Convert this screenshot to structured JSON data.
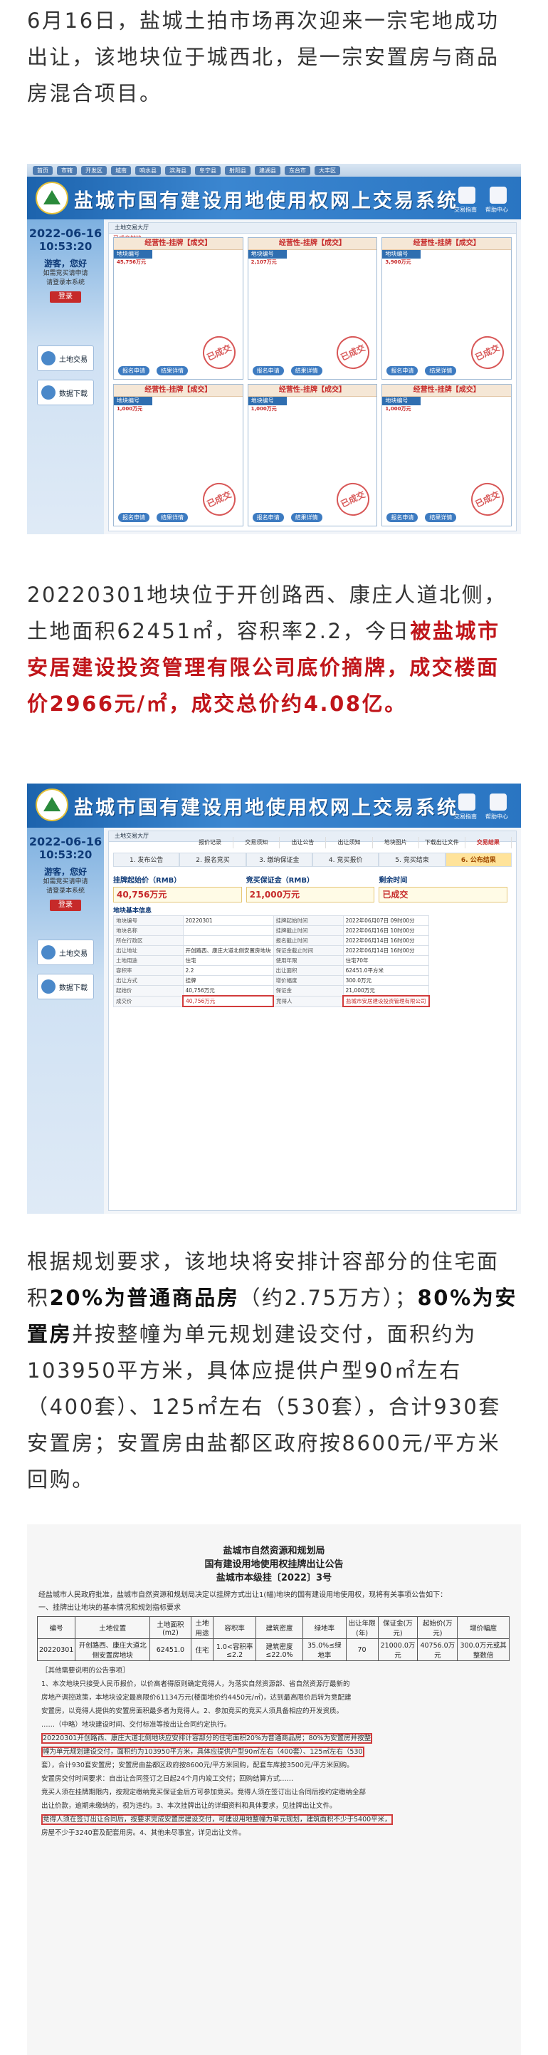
{
  "paragraphs": {
    "p1": "6月16日，盐城土拍市场再次迎来一宗宅地成功出让，该地块位于城西北，是一宗安置房与商品房混合项目。",
    "p2_a": "20220301地块位于开创路西、康庄人道北侧，土地面积62451㎡，容积率2.2，今日",
    "p2_red": "被盐城市安居建设投资管理有限公司底价摘牌，成交楼面价2966元/㎡，成交总价约4.08亿。",
    "p3_a": "根据规划要求，该地块将安排计容部分的住宅面积",
    "p3_b1": "20%为普通商品房",
    "p3_c": "（约2.75万方）；",
    "p3_b2": "80%为安置房",
    "p3_d": "并按整幢为单元规划建设交付，面积约为103950平方米，具体应提供户型90㎡左右（400套）、125㎡左右（530套），合计930套安置房；安置房由盐都区政府按8600元/平方米回购。"
  },
  "site": {
    "title": "盐城市国有建设用地使用权网上交易系统",
    "nav": [
      "首页",
      "市辖",
      "开发区",
      "城南",
      "响水县",
      "滨海县",
      "阜宁县",
      "射阳县",
      "建湖县",
      "东台市",
      "大丰区"
    ],
    "hdr_icons": [
      "交易指南",
      "帮助中心"
    ],
    "sidebar": {
      "greet": "游客，您好",
      "tip1": "如需竞买请申请",
      "tip2": "请登录本系统",
      "login": "登录",
      "btn1": "土地交易",
      "btn2": "数据下载"
    }
  },
  "shot1": {
    "date": "2022-06-16",
    "time": "10:53:20",
    "tab": "土地交易大厅",
    "subtab": "已成交地块",
    "cards": [
      {
        "title": "经营性-挂牌【成交】",
        "code": "地块编号",
        "price": "45,756万元",
        "stamp": "已成交"
      },
      {
        "title": "经营性-挂牌【成交】",
        "code": "地块编号",
        "price": "2,107万元",
        "stamp": "已成交"
      },
      {
        "title": "经营性-挂牌【成交】",
        "code": "地块编号",
        "price": "3,900万元",
        "stamp": "已成交"
      },
      {
        "title": "经营性-挂牌【成交】",
        "code": "地块编号",
        "price": "1,000万元",
        "stamp": "已成交"
      },
      {
        "title": "经营性-挂牌【成交】",
        "code": "地块编号",
        "price": "1,000万元",
        "stamp": "已成交"
      },
      {
        "title": "经营性-挂牌【成交】",
        "code": "地块编号",
        "price": "1,000万元",
        "stamp": "已成交"
      }
    ],
    "btn_detail": "报名申请",
    "btn_result": "结果详情"
  },
  "shot2": {
    "date": "2022-06-16",
    "time": "10:53:20",
    "tab": "土地交易大厅",
    "subtabs": [
      "报价记录",
      "交易须知",
      "出让公告",
      "出让须知",
      "地块图片",
      "下载出让文件",
      "交易结果"
    ],
    "steps": [
      "发布公告",
      "报名竞买",
      "缴纳保证金",
      "竞买报价",
      "竞买结束",
      "公布结果"
    ],
    "kpis": [
      {
        "label": "挂牌起始价（RMB）",
        "value": "40,756万元"
      },
      {
        "label": "竞买保证金（RMB）",
        "value": "21,000万元"
      },
      {
        "label": "剩余时间",
        "value": "已成交"
      }
    ],
    "section": "地块基本信息",
    "rows": [
      [
        "地块编号",
        "20220301",
        "挂牌起始时间",
        "2022年06月07日 09时00分"
      ],
      [
        "地块名称",
        "",
        "挂牌截止时间",
        "2022年06月16日 10时00分"
      ],
      [
        "所在行政区",
        "",
        "报名截止时间",
        "2022年06月14日 16时00分"
      ],
      [
        "出让地址",
        "开创路西、康庄大道北侧安置房地块",
        "保证金截止时间",
        "2022年06月14日 16时00分"
      ],
      [
        "土地用途",
        "住宅",
        "使用年限",
        "住宅70年"
      ],
      [
        "容积率",
        "2.2",
        "出让面积",
        "62451.0平方米"
      ],
      [
        "出让方式",
        "挂牌",
        "增价幅度",
        "300.0万元"
      ],
      [
        "起始价",
        "40,756万元",
        "保证金",
        "21,000万元"
      ],
      [
        "成交价",
        "40,756万元",
        "竞得人",
        "盐城市安居建设投资管理有限公司"
      ]
    ]
  },
  "notice": {
    "t1": "盐城市自然资源和规划局",
    "t2": "国有建设用地使用权挂牌出让公告",
    "t3": "盐城市本级挂〔2022〕3号",
    "intro": "经盐城市人民政府批准，盐城市自然资源和规划局决定以挂牌方式出让1(幅)地块的国有建设用地使用权，现将有关事项公告如下：",
    "sec1": "一、挂牌出让地块的基本情况和规划指标要求",
    "headers": [
      "编号",
      "土地位置",
      "土地面积(m2)",
      "土地用途",
      "容积率",
      "建筑密度",
      "绿地率",
      "出让年限(年)",
      "保证金(万元)",
      "起始价(万元)",
      "增价幅度"
    ],
    "row": [
      "20220301",
      "开创路西、康庄大道北侧安置房地块",
      "62451.0",
      "住宅",
      "1.0<容积率≤2.2",
      "建筑密度≤22.0%",
      "35.0%≤绿地率",
      "70",
      "21000.0万元",
      "40756.0万元",
      "300.0万元或其整数倍"
    ],
    "other": "［其他需要说明的公告事项］",
    "body": [
      "1、本次地块只接受人民币报价，以价高者得原则确定竞得人，为落实自然资源部、省自然资源厅最新的",
      "房地产调控政策，本地块设定最高限价61134万元(楼面地价约4450元/㎡)，达到最高限价后转为竞配建",
      "安置房，以竞得人提供的安置房面积最多者为竞得人。2、参加竞买的竞买人须具备相应的开发资质。",
      "……（中略）地块建设时间、交付标准等按出让合同约定执行。",
      "20220301开创路西、康庄大道北侧地块应安排计容部分的住宅面积20%为普通商品房；80%为安置房并按整",
      "幢为单元规划建设交付，面积约为103950平方米，具体应提供户型90㎡左右（400套）、125㎡左右（530",
      "套），合计930套安置房；安置房由盐都区政府按8600元/平方米回购，配套车库按3500元/平方米回购。",
      "安置房交付时间要求：自出让合同签订之日起24个月内竣工交付；回购结算方式……",
      "竞买人须在挂牌期限内，按规定缴纳竞买保证金后方可参加竞买。竞得人须在签订出让合同后按约定缴纳全部",
      "出让价款，逾期未缴纳的，视为违约。3、本次挂牌出让的详细资料和具体要求，见挂牌出让文件。",
      "竞得人须在签订出让合同后，按要求完成安置房建设交付，可建设用地整幢为单元规划，建筑面积不少于5400平米，",
      "房屋不少于3240套及配套用房。4、其他未尽事宜，详见出让文件。"
    ]
  }
}
